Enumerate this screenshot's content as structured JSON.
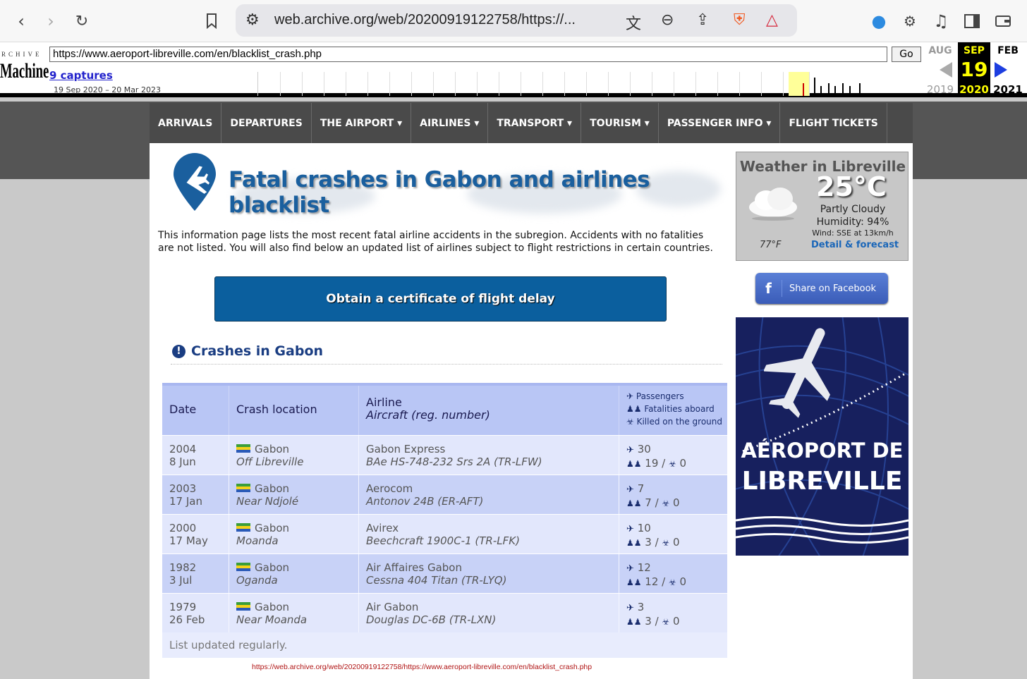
{
  "browser": {
    "url": "web.archive.org/web/20200919122758/https://..."
  },
  "wayback": {
    "logo_top": "RCHIVE",
    "logo": "Machine",
    "url": "https://www.aeroport-libreville.com/en/blacklist_crash.php",
    "go": "Go",
    "captures": "9 captures",
    "range": "19 Sep 2020 – 20 Mar 2023",
    "cal": {
      "prev_month": "AUG",
      "cur_month": "SEP",
      "next_month": "FEB",
      "day": "19",
      "prev_year": "2019",
      "cur_year": "2020",
      "next_year": "2021"
    }
  },
  "menu": [
    {
      "label": "ARRIVALS"
    },
    {
      "label": "DEPARTURES"
    },
    {
      "label": "THE AIRPORT ▾"
    },
    {
      "label": "AIRLINES ▾"
    },
    {
      "label": "TRANSPORT ▾"
    },
    {
      "label": "TOURISM ▾"
    },
    {
      "label": "PASSENGER INFO ▾"
    },
    {
      "label": "FLIGHT TICKETS"
    }
  ],
  "hero_title": "Fatal crashes in Gabon and airlines blacklist",
  "intro": "This information page lists the most recent fatal airline accidents in the subregion. Accidents with no fatalities are not listed. You will also find below an updated list of airlines subject to flight restrictions in certain countries.",
  "cert_button": "Obtain a certificate of flight delay",
  "crash_heading": "Crashes in Gabon",
  "table": {
    "headers": {
      "date": "Date",
      "location": "Crash location",
      "airline": "Airline",
      "aircraft": "Aircraft (reg. number)",
      "passengers": "Passengers",
      "fatalities": "Fatalities aboard",
      "ground": "Killed on the ground"
    },
    "rows": [
      {
        "year": "2004",
        "day": "8 Jun",
        "country": "Gabon",
        "place": "Off Libreville",
        "airline": "Gabon Express",
        "aircraft": "BAe HS-748-232 Srs 2A (TR-LFW)",
        "pax": "30",
        "fat": "19",
        "ground": "0"
      },
      {
        "year": "2003",
        "day": "17 Jan",
        "country": "Gabon",
        "place": "Near Ndjolé",
        "airline": "Aerocom",
        "aircraft": "Antonov 24B (ER-AFT)",
        "pax": "7",
        "fat": "7",
        "ground": "0"
      },
      {
        "year": "2000",
        "day": "17 May",
        "country": "Gabon",
        "place": "Moanda",
        "airline": "Avirex",
        "aircraft": "Beechcraft 1900C-1 (TR-LFK)",
        "pax": "10",
        "fat": "3",
        "ground": "0"
      },
      {
        "year": "1982",
        "day": "3 Jul",
        "country": "Gabon",
        "place": "Oganda",
        "airline": "Air Affaires Gabon",
        "aircraft": "Cessna 404 Titan (TR-LYQ)",
        "pax": "12",
        "fat": "12",
        "ground": "0"
      },
      {
        "year": "1979",
        "day": "26 Feb",
        "country": "Gabon",
        "place": "Near Moanda",
        "airline": "Air Gabon",
        "aircraft": "Douglas DC-6B (TR-LXN)",
        "pax": "3",
        "fat": "3",
        "ground": "0"
      }
    ],
    "footer": "List updated regularly."
  },
  "status_url": "https://web.archive.org/web/20200919122758/https://www.aeroport-libreville.com/en/blacklist_crash.php",
  "weather": {
    "title": "Weather in Libreville",
    "temp": "25°C",
    "condition": "Partly Cloudy",
    "humidity": "Humidity: 94%",
    "wind": "Wind: SSE at 13km/h",
    "fahrenheit": "77°F",
    "link": "Detail & forecast"
  },
  "facebook": {
    "f": "f",
    "label": "Share on Facebook"
  },
  "ad": {
    "line1": "AÉROPORT DE",
    "line2": "LIBREVILLE"
  },
  "colors": {
    "accent": "#0b5f9e",
    "menu": "#4a4a4a",
    "table_header": "#b9c6f5",
    "ad_bg": "#17205e"
  }
}
